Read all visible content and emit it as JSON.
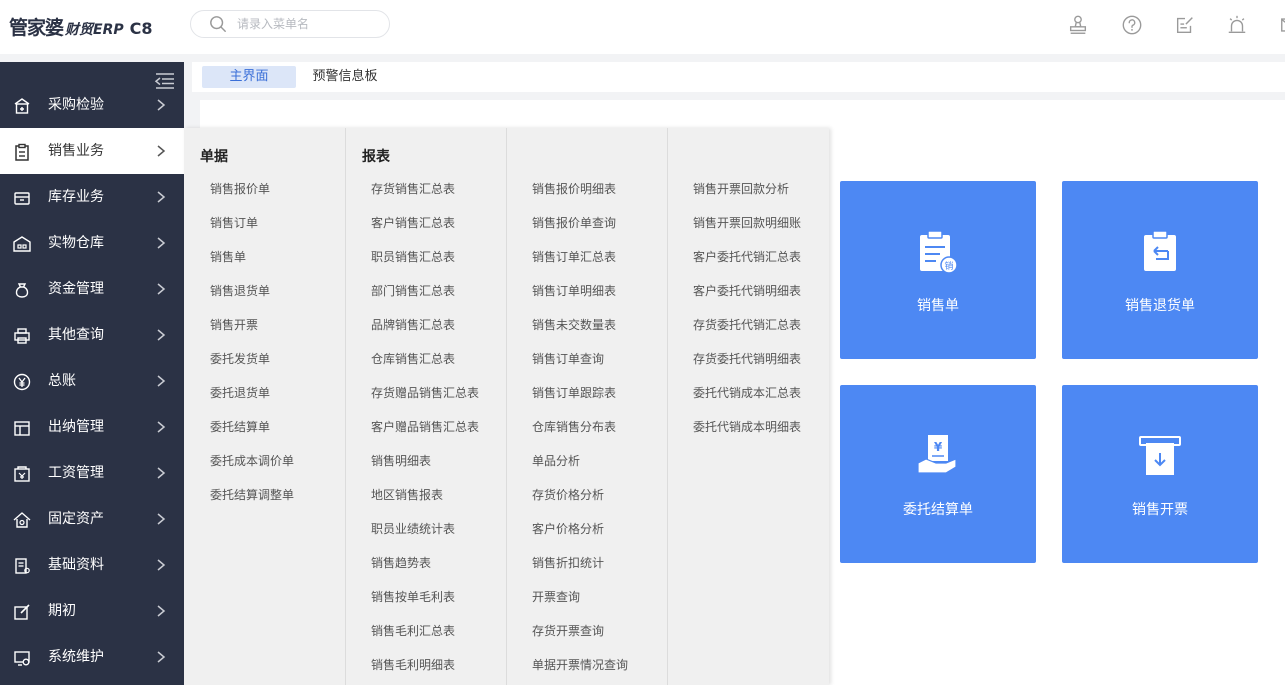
{
  "header": {
    "logo_brand": "管家婆",
    "logo_erp": "财贸ERP",
    "logo_version": "C8",
    "search_placeholder": "请录入菜单名",
    "icons": [
      "stamp-icon",
      "help-icon",
      "edit-note-icon",
      "alarm-icon",
      "mail-icon"
    ]
  },
  "sidebar": {
    "items": [
      {
        "label": "采购检验",
        "icon": "shop-icon"
      },
      {
        "label": "销售业务",
        "icon": "clipboard-icon"
      },
      {
        "label": "库存业务",
        "icon": "inventory-icon"
      },
      {
        "label": "实物仓库",
        "icon": "warehouse-icon"
      },
      {
        "label": "资金管理",
        "icon": "money-bag-icon"
      },
      {
        "label": "其他查询",
        "icon": "printer-icon"
      },
      {
        "label": "总账",
        "icon": "yen-icon"
      },
      {
        "label": "出纳管理",
        "icon": "cashier-icon"
      },
      {
        "label": "工资管理",
        "icon": "salary-icon"
      },
      {
        "label": "固定资产",
        "icon": "house-icon"
      },
      {
        "label": "基础资料",
        "icon": "document-icon"
      },
      {
        "label": "期初",
        "icon": "edit-box-icon"
      },
      {
        "label": "系统维护",
        "icon": "system-icon"
      }
    ],
    "active_index": 1
  },
  "tabs": [
    {
      "label": "主界面"
    },
    {
      "label": "预警信息板"
    }
  ],
  "dropdown": {
    "doc_header": "单据",
    "report_header": "报表",
    "docs": [
      "销售报价单",
      "销售订单",
      "销售单",
      "销售退货单",
      "销售开票",
      "委托发货单",
      "委托退货单",
      "委托结算单",
      "委托成本调价单",
      "委托结算调整单"
    ],
    "reports_col1": [
      "存货销售汇总表",
      "客户销售汇总表",
      "职员销售汇总表",
      "部门销售汇总表",
      "品牌销售汇总表",
      "仓库销售汇总表",
      "存货赠品销售汇总表",
      "客户赠品销售汇总表",
      "销售明细表",
      "地区销售报表",
      "职员业绩统计表",
      "销售趋势表",
      "销售按单毛利表",
      "销售毛利汇总表",
      "销售毛利明细表"
    ],
    "reports_col2": [
      "销售报价明细表",
      "销售报价单查询",
      "销售订单汇总表",
      "销售订单明细表",
      "销售未交数量表",
      "销售订单查询",
      "销售订单跟踪表",
      "仓库销售分布表",
      "单品分析",
      "存货价格分析",
      "客户价格分析",
      "销售折扣统计",
      "开票查询",
      "存货开票查询",
      "单据开票情况查询"
    ],
    "reports_col3": [
      "销售开票回款分析",
      "销售开票回款明细账",
      "客户委托代销汇总表",
      "客户委托代销明细表",
      "存货委托代销汇总表",
      "存货委托代销明细表",
      "委托代销成本汇总表",
      "委托代销成本明细表"
    ]
  },
  "tiles": [
    {
      "label": "销售单",
      "icon": "sales-order-icon",
      "badge": "销"
    },
    {
      "label": "销售退货单",
      "icon": "sales-return-icon"
    },
    {
      "label": "委托结算单",
      "icon": "settlement-icon",
      "badge": "¥"
    },
    {
      "label": "销售开票",
      "icon": "invoice-icon"
    }
  ],
  "colors": {
    "sidebar_bg": "#2b3245",
    "tile_bg": "#4d88f3",
    "tab_active": "#dce6f8"
  }
}
